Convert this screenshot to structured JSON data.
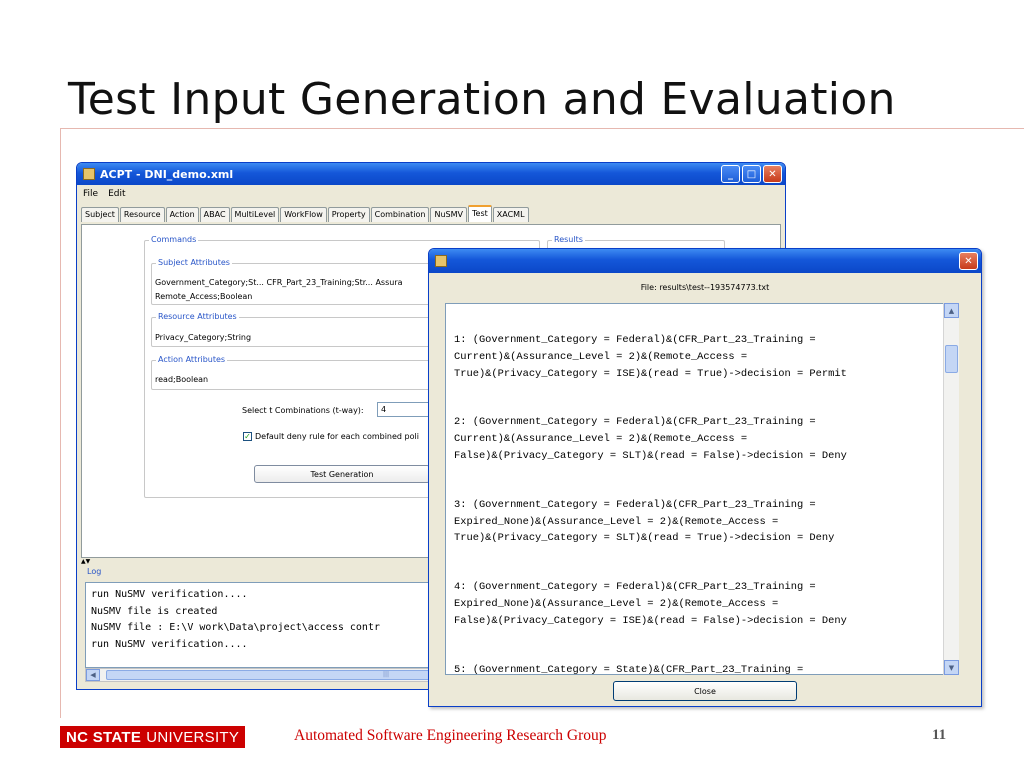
{
  "slide": {
    "title": "Test Input Generation and Evaluation",
    "footer_logo_bold": "NC STATE",
    "footer_logo_rest": "UNIVERSITY",
    "footer_group": "Automated Software Engineering Research Group",
    "page_number": "11"
  },
  "acpt_window": {
    "title": "ACPT - DNI_demo.xml",
    "menu": [
      "File",
      "Edit"
    ],
    "tabs": [
      "Subject",
      "Resource",
      "Action",
      "ABAC",
      "MultiLevel",
      "WorkFlow",
      "Property",
      "Combination",
      "NuSMV",
      "Test",
      "XACML"
    ],
    "active_tab": "Test",
    "commands_label": "Commands",
    "results_label": "Results",
    "subject_attributes": {
      "label": "Subject Attributes",
      "line1": "Government_Category;St... CFR_Part_23_Training;Str... Assura",
      "line2": "Remote_Access;Boolean"
    },
    "resource_attributes": {
      "label": "Resource Attributes",
      "value": "Privacy_Category;String"
    },
    "action_attributes": {
      "label": "Action Attributes",
      "value": "read;Boolean"
    },
    "t_combinations_label": "Select t Combinations (t-way):",
    "t_combinations_value": "4",
    "default_deny_label": "Default deny rule for each combined poli",
    "test_generation_button": "Test Generation",
    "log": {
      "label": "Log",
      "lines": [
        "run NuSMV verification....",
        "NuSMV file is created",
        "NuSMV file : E:\\V work\\Data\\project\\access contr",
        "run NuSMV verification...."
      ]
    }
  },
  "results_dialog": {
    "file_label": "File: results\\test--193574773.txt",
    "records": [
      [
        "1:  (Government_Category = Federal)&(CFR_Part_23_Training =",
        "Current)&(Assurance_Level = 2)&(Remote_Access =",
        "True)&(Privacy_Category = ISE)&(read = True)->decision = Permit"
      ],
      [
        "2:  (Government_Category = Federal)&(CFR_Part_23_Training =",
        "Current)&(Assurance_Level = 2)&(Remote_Access =",
        "False)&(Privacy_Category = SLT)&(read = False)->decision = Deny"
      ],
      [
        "3:  (Government_Category = Federal)&(CFR_Part_23_Training =",
        "Expired_None)&(Assurance_Level = 2)&(Remote_Access =",
        "True)&(Privacy_Category = SLT)&(read = True)->decision = Deny"
      ],
      [
        "4:  (Government_Category = Federal)&(CFR_Part_23_Training =",
        "Expired_None)&(Assurance_Level = 2)&(Remote_Access =",
        "False)&(Privacy_Category = ISE)&(read = False)->decision = Deny"
      ],
      [
        "5:  (Government_Category = State)&(CFR_Part_23_Training ="
      ]
    ],
    "close_button": "Close"
  }
}
